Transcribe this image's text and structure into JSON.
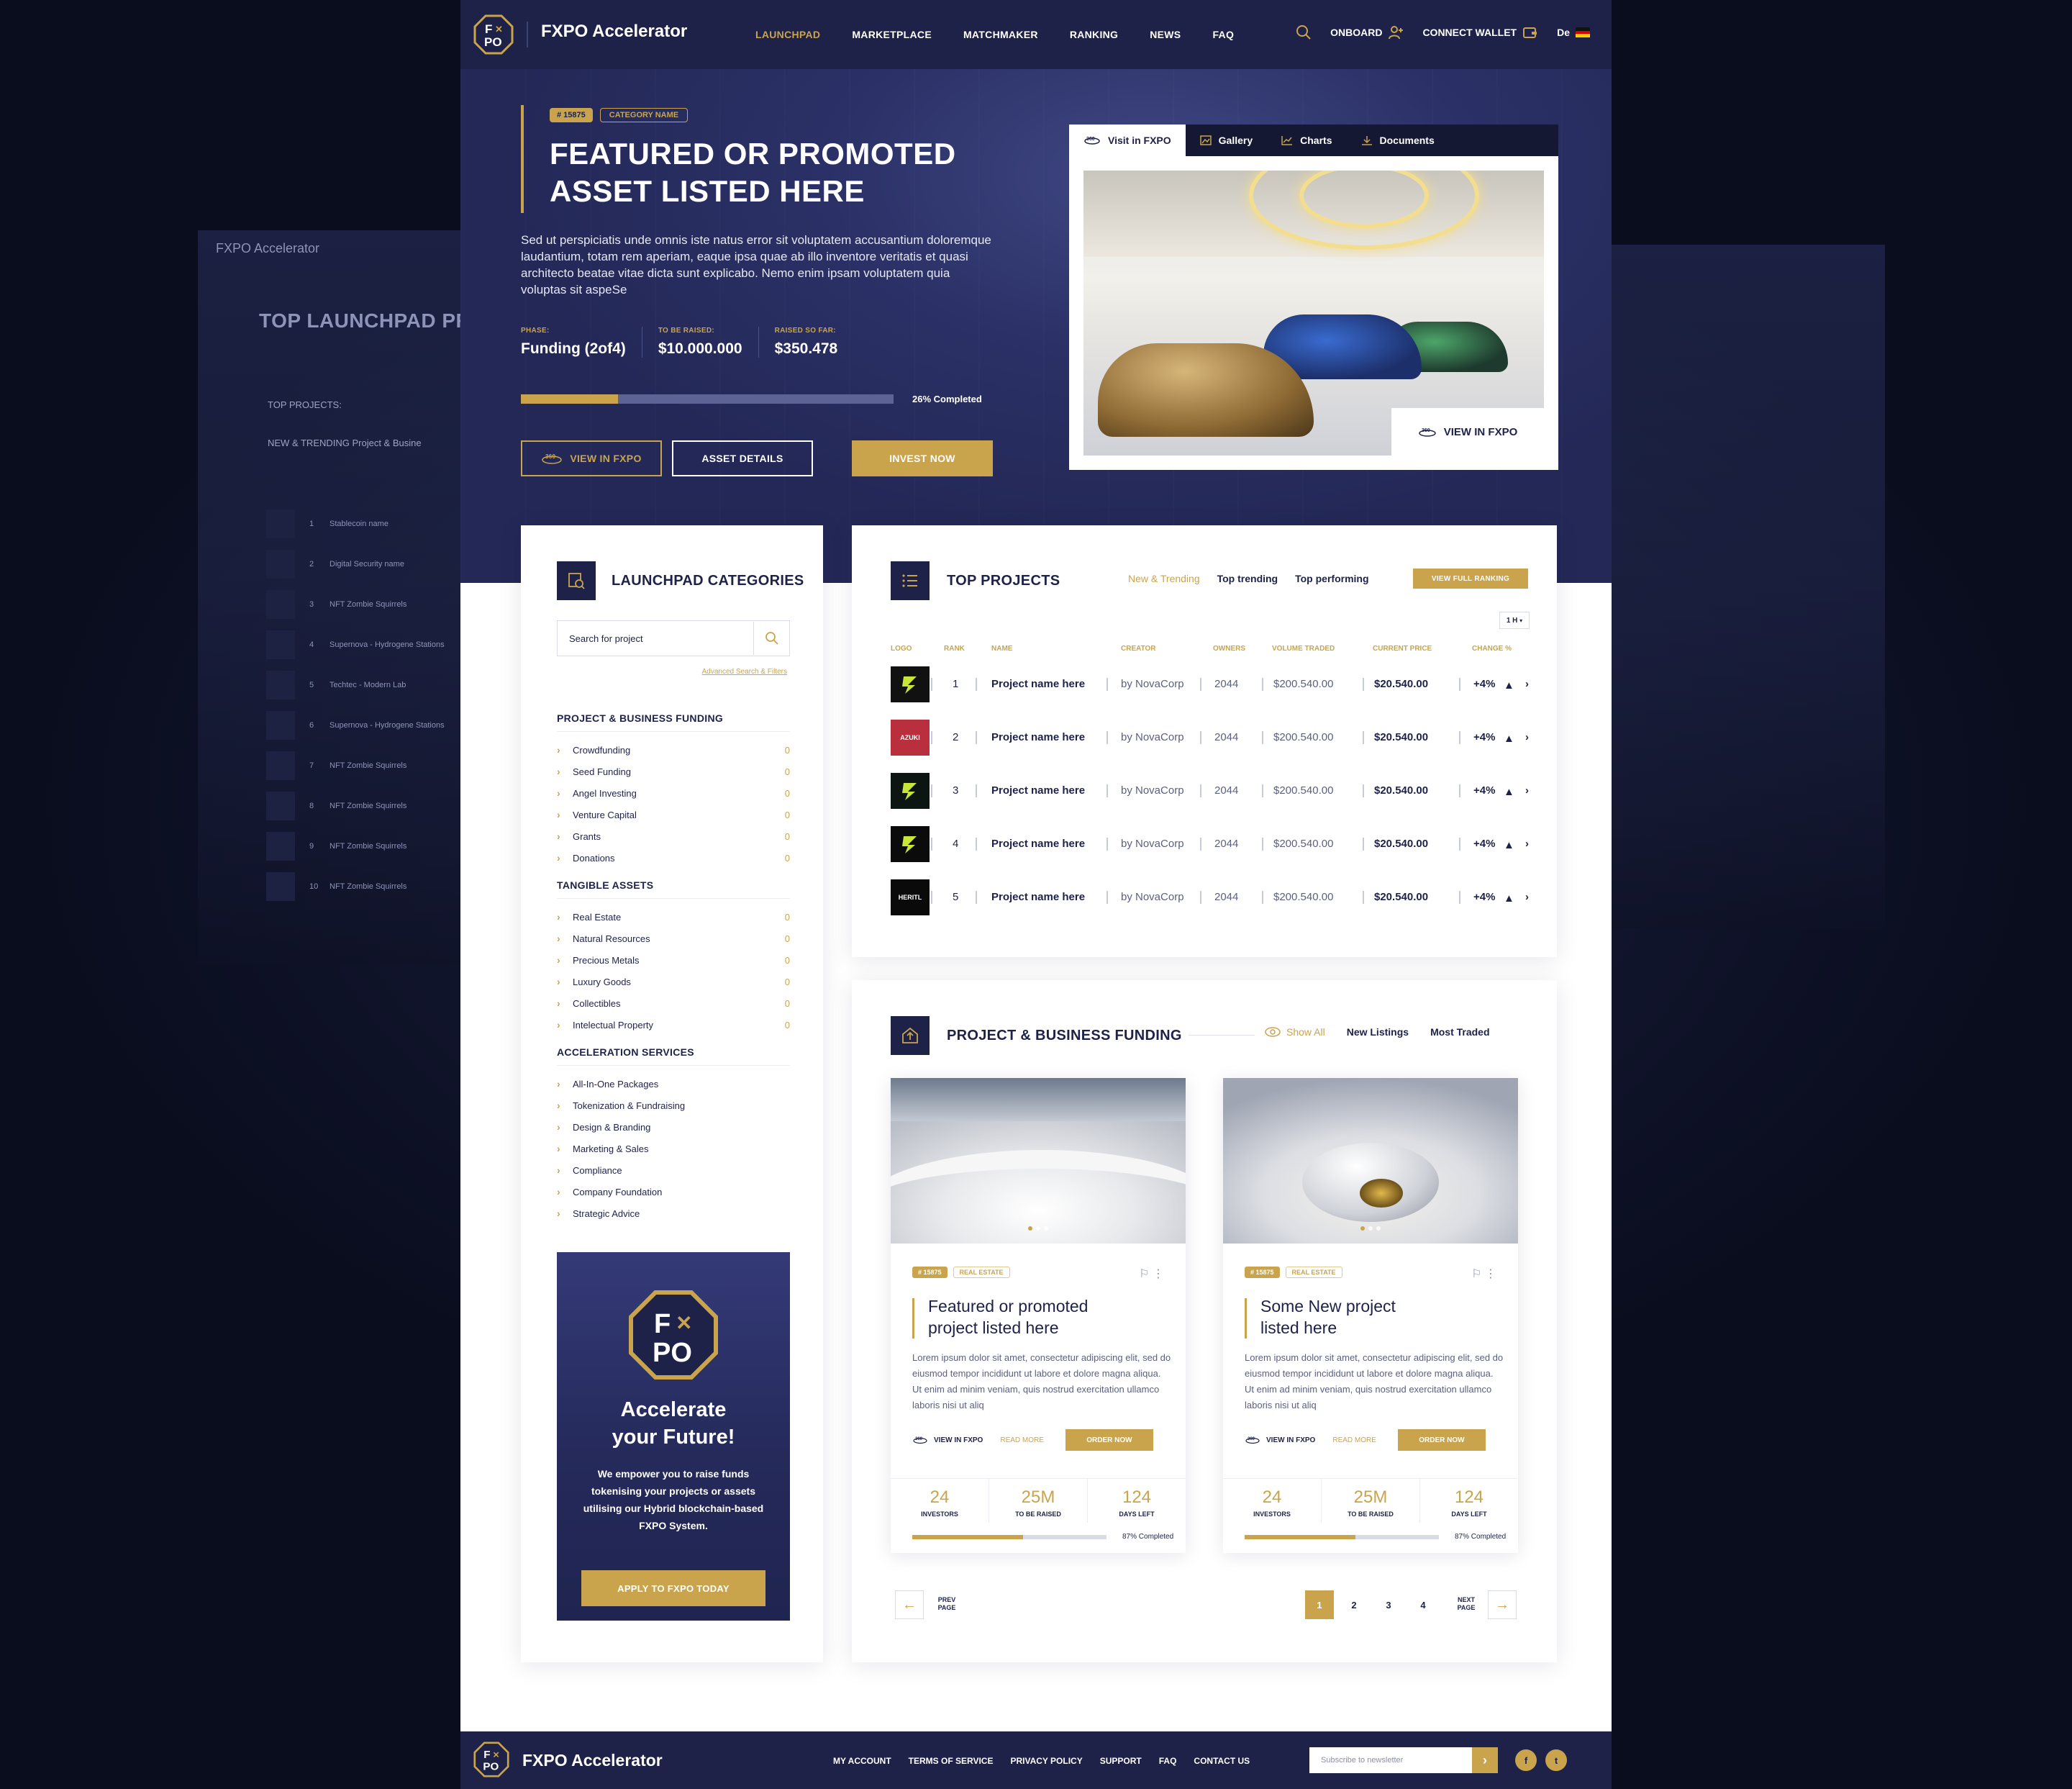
{
  "brand": {
    "name": "FXPO Accelerator",
    "logo_top": "F",
    "logo_x": "✕",
    "logo_bottom": "PO"
  },
  "nav": {
    "links": [
      "LAUNCHPAD",
      "MARKETPLACE",
      "MATCHMAKER",
      "RANKING",
      "NEWS",
      "FAQ"
    ],
    "onboard": "ONBOARD",
    "connect_wallet": "CONNECT WALLET",
    "language": "De"
  },
  "ghost": {
    "brand": "FXPO Accelerator",
    "title": "TOP LAUNCHPAD PR",
    "subhead": "TOP PROJECTS:",
    "sub2": "NEW & TRENDING   Project & Busine",
    "rows": [
      "Stablecoin name",
      "Digital Security  name",
      "NFT Zombie Squirrels",
      "Supernova - Hydrogene Stations",
      "Techtec - Modern Lab",
      "Supernova - Hydrogene Stations",
      "NFT Zombie Squirrels",
      "NFT Zombie Squirrels",
      "NFT Zombie Squirrels",
      "NFT Zombie Squirrels"
    ]
  },
  "hero": {
    "tag_id": "# 15875",
    "tag_category": "CATEGORY NAME",
    "title_line1": "FEATURED OR PROMOTED",
    "title_line2": "ASSET LISTED HERE",
    "description": "Sed ut perspiciatis unde omnis iste natus error sit voluptatem accusantium doloremque laudantium, totam rem aperiam, eaque ipsa quae ab illo inventore veritatis et quasi architecto beatae vitae dicta sunt explicabo. Nemo enim ipsam voluptatem quia voluptas sit aspeSe",
    "stats": [
      {
        "label": "PHASE:",
        "value": "Funding (2of4)"
      },
      {
        "label": "TO BE RAISED:",
        "value": "$10.000.000"
      },
      {
        "label": "RAISED SO FAR:",
        "value": "$350.478"
      }
    ],
    "progress_pct": 26,
    "progress_label": "26%  Completed",
    "btn_view": "VIEW IN FXPO",
    "btn_details": "ASSET DETAILS",
    "btn_invest": "INVEST NOW",
    "media_tabs": [
      "Visit in FXPO",
      "Gallery",
      "Charts",
      "Documents"
    ],
    "media_view_btn": "VIEW IN FXPO"
  },
  "categories": {
    "title": "LAUNCHPAD CATEGORIES",
    "search_placeholder": "Search for project",
    "advanced": "Advanced Search & Filters",
    "sections": [
      {
        "heading": "PROJECT & BUSINESS FUNDING",
        "items": [
          {
            "label": "Crowdfunding",
            "count": "0"
          },
          {
            "label": "Seed Funding",
            "count": "0"
          },
          {
            "label": "Angel Investing",
            "count": "0"
          },
          {
            "label": "Venture Capital",
            "count": "0"
          },
          {
            "label": "Grants",
            "count": "0"
          },
          {
            "label": "Donations",
            "count": "0"
          }
        ]
      },
      {
        "heading": "TANGIBLE ASSETS",
        "items": [
          {
            "label": "Real Estate",
            "count": "0"
          },
          {
            "label": "Natural Resources",
            "count": "0"
          },
          {
            "label": "Precious Metals",
            "count": "0"
          },
          {
            "label": "Luxury Goods",
            "count": "0"
          },
          {
            "label": "Collectibles",
            "count": "0"
          },
          {
            "label": "Intelectual Property",
            "count": "0"
          }
        ]
      },
      {
        "heading": "ACCELERATION SERVICES",
        "items": [
          {
            "label": "All-In-One Packages",
            "count": ""
          },
          {
            "label": "Tokenization & Fundraising",
            "count": ""
          },
          {
            "label": "Design & Branding",
            "count": ""
          },
          {
            "label": "Marketing & Sales",
            "count": ""
          },
          {
            "label": "Compliance",
            "count": ""
          },
          {
            "label": "Company Foundation",
            "count": ""
          },
          {
            "label": "Strategic Advice",
            "count": ""
          }
        ]
      }
    ],
    "promo": {
      "title_line1": "Accelerate",
      "title_line2": "your Future!",
      "description": "We empower you to raise funds tokenising your projects or assets utilising our Hybrid blockchain-based FXPO System.",
      "button": "APPLY TO FXPO TODAY"
    }
  },
  "top_projects": {
    "title": "TOP PROJECTS",
    "tabs": [
      "New & Trending",
      "Top trending",
      "Top performing"
    ],
    "full_ranking": "VIEW FULL RANKING",
    "period": "1 H",
    "columns": [
      "LOGO",
      "RANK",
      "NAME",
      "CREATOR",
      "OWNERS",
      "VOLUME TRADED",
      "CURRENT PRICE",
      "CHANGE %"
    ],
    "rows": [
      {
        "rank": "1",
        "name": "Project name here",
        "creator": "by NovaCorp",
        "owners": "2044",
        "volume": "$200.540.00",
        "price": "$20.540.00",
        "change": "+4%",
        "logo_text": "",
        "logo_color": "#111111"
      },
      {
        "rank": "2",
        "name": "Project name here",
        "creator": "by NovaCorp",
        "owners": "2044",
        "volume": "$200.540.00",
        "price": "$20.540.00",
        "change": "+4%",
        "logo_text": "AZUKI",
        "logo_color": "#b92f3d"
      },
      {
        "rank": "3",
        "name": "Project name here",
        "creator": "by NovaCorp",
        "owners": "2044",
        "volume": "$200.540.00",
        "price": "$20.540.00",
        "change": "+4%",
        "logo_text": "",
        "logo_color": "#0d1512"
      },
      {
        "rank": "4",
        "name": "Project name here",
        "creator": "by NovaCorp",
        "owners": "2044",
        "volume": "$200.540.00",
        "price": "$20.540.00",
        "change": "+4%",
        "logo_text": "",
        "logo_color": "#0b0b0b"
      },
      {
        "rank": "5",
        "name": "Project name here",
        "creator": "by NovaCorp",
        "owners": "2044",
        "volume": "$200.540.00",
        "price": "$20.540.00",
        "change": "+4%",
        "logo_text": "HERITL",
        "logo_color": "#0a0a0a"
      }
    ]
  },
  "funding": {
    "title": "PROJECT & BUSINESS FUNDING",
    "tabs": [
      "Show All",
      "New Listings",
      "Most Traded"
    ],
    "projects": [
      {
        "tag_id": "# 15875",
        "tag_cat": "REAL ESTATE",
        "title_line1": "Featured or promoted",
        "title_line2": "project listed here",
        "description": "Lorem ipsum dolor sit amet, consectetur adipiscing elit, sed do eiusmod tempor incididunt ut labore et dolore magna aliqua. Ut enim ad minim veniam, quis nostrud exercitation ullamco laboris nisi ut aliq",
        "view": "VIEW IN FXPO",
        "read": "READ MORE",
        "order": "ORDER NOW",
        "stats": [
          {
            "n": "24",
            "l": "INVESTORS"
          },
          {
            "n": "25M",
            "l": "TO BE RAISED"
          },
          {
            "n": "124",
            "l": "DAYS LEFT"
          }
        ],
        "progress_pct": 57,
        "progress_label": "87% Completed"
      },
      {
        "tag_id": "# 15875",
        "tag_cat": "REAL ESTATE",
        "title_line1": "Some New project",
        "title_line2": "listed here",
        "description": "Lorem ipsum dolor sit amet, consectetur adipiscing elit, sed do eiusmod tempor incididunt ut labore et dolore magna aliqua. Ut enim ad minim veniam, quis nostrud exercitation ullamco laboris nisi ut aliq",
        "view": "VIEW IN FXPO",
        "read": "READ MORE",
        "order": "ORDER NOW",
        "stats": [
          {
            "n": "24",
            "l": "INVESTORS"
          },
          {
            "n": "25M",
            "l": "TO BE RAISED"
          },
          {
            "n": "124",
            "l": "DAYS LEFT"
          }
        ],
        "progress_pct": 57,
        "progress_label": "87% Completed"
      }
    ],
    "pager": {
      "prev": "PREV PAGE",
      "next": "NEXT PAGE",
      "pages": [
        "1",
        "2",
        "3",
        "4"
      ],
      "current": "1"
    }
  },
  "footer": {
    "brand": "FXPO Accelerator",
    "links": [
      "MY ACCOUNT",
      "TERMS OF SERVICE",
      "PRIVACY POLICY",
      "SUPPORT",
      "FAQ",
      "CONTACT US"
    ],
    "newsletter_placeholder": "Subscribe to newsletter",
    "social": [
      "f",
      "t"
    ]
  },
  "colors": {
    "navy": "#1e2249",
    "gold": "#c9a44d",
    "hero": "#2b3166"
  }
}
